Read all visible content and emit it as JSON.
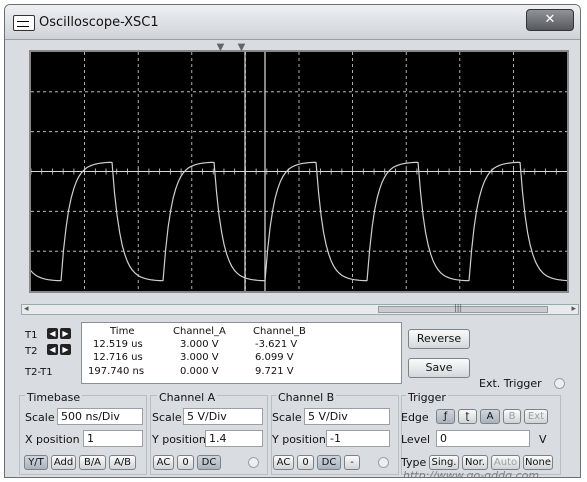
{
  "window": {
    "title": "Oscilloscope-XSC1",
    "close_symbol": "✕"
  },
  "scope": {
    "background": "#000000",
    "grid_color": "#d8d8d8",
    "trace_color": "#cfcfcf",
    "cursor_color": "#e0e0e0",
    "marker_symbols": [
      "▼",
      "▼"
    ]
  },
  "scrollbar": {
    "left_arrow": "◂",
    "right_arrow": "▸",
    "thumb_grip": "|||"
  },
  "readout": {
    "headers": {
      "time": "Time",
      "channel_a": "Channel_A",
      "channel_b": "Channel_B"
    },
    "rows": [
      {
        "label": "T1",
        "time": "12.519 us",
        "channel_a": "3.000 V",
        "channel_b": "-3.621 V"
      },
      {
        "label": "T2",
        "time": "12.716 us",
        "channel_a": "3.000 V",
        "channel_b": "6.099 V"
      },
      {
        "label": "T2-T1",
        "time": "197.740 ns",
        "channel_a": "0.000 V",
        "channel_b": "9.721 V"
      }
    ]
  },
  "buttons": {
    "reverse": "Reverse",
    "save": "Save",
    "ext_trigger": "Ext. Trigger"
  },
  "timebase": {
    "title": "Timebase",
    "scale_label": "Scale",
    "scale_value": "500 ns/Div",
    "xpos_label": "X position",
    "xpos_value": "1",
    "modes": [
      "Y/T",
      "Add",
      "B/A",
      "A/B"
    ]
  },
  "channel_a": {
    "title": "Channel A",
    "scale_label": "Scale",
    "scale_value": "5  V/Div",
    "ypos_label": "Y position",
    "ypos_value": "1.4",
    "coupling": [
      "AC",
      "0",
      "DC"
    ]
  },
  "channel_b": {
    "title": "Channel B",
    "scale_label": "Scale",
    "scale_value": "5  V/Div",
    "ypos_label": "Y position",
    "ypos_value": "-1",
    "coupling": [
      "AC",
      "0",
      "DC",
      "-"
    ]
  },
  "trigger": {
    "title": "Trigger",
    "edge_label": "Edge",
    "edge_buttons": [
      "ƒ",
      "ʈ",
      "A",
      "B",
      "Ext"
    ],
    "level_label": "Level",
    "level_value": "0",
    "level_unit": "V",
    "type_label": "Type",
    "type_buttons": [
      "Sing.",
      "Nor.",
      "Auto",
      "None"
    ]
  },
  "watermark": "http://www.go-gddq.com"
}
